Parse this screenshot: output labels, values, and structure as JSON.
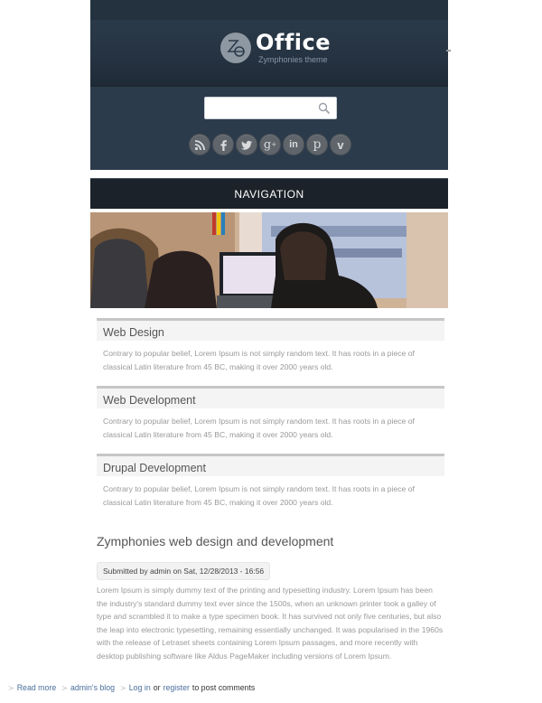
{
  "header": {
    "logo_mark": "Ze",
    "title": "Office",
    "subtitle": "Zymphonies theme"
  },
  "search": {
    "value": "",
    "placeholder": ""
  },
  "social": [
    {
      "name": "rss",
      "icon": "rss-icon"
    },
    {
      "name": "facebook",
      "icon": "facebook-icon"
    },
    {
      "name": "twitter",
      "icon": "twitter-icon"
    },
    {
      "name": "google-plus",
      "icon": "google-plus-icon"
    },
    {
      "name": "linkedin",
      "icon": "linkedin-icon"
    },
    {
      "name": "pinterest",
      "icon": "pinterest-icon"
    },
    {
      "name": "vimeo",
      "icon": "vimeo-icon"
    }
  ],
  "nav": {
    "label": "NAVIGATION"
  },
  "blocks": [
    {
      "title": "Web Design",
      "body": "Contrary to popular belief, Lorem Ipsum is not simply random text. It has roots in a piece of classical Latin literature from 45 BC, making it over 2000 years old."
    },
    {
      "title": "Web Development",
      "body": "Contrary to popular belief, Lorem Ipsum is not simply random text. It has roots in a piece of classical Latin literature from 45 BC, making it over 2000 years old."
    },
    {
      "title": "Drupal Development",
      "body": "Contrary to popular belief, Lorem Ipsum is not simply random text. It has roots in a piece of classical Latin literature from 45 BC, making it over 2000 years old."
    }
  ],
  "article": {
    "title": "Zymphonies web design and development",
    "submitted": "Submitted by admin on Sat, 12/28/2013 - 16:56",
    "body": "Lorem Ipsum is simply dummy text of the printing and typesetting industry. Lorem Ipsum has been the industry's standard dummy text ever since the 1500s, when an unknown printer took a galley of type and scrambled it to make a type specimen book. It has survived not only five centuries, but also the leap into electronic typesetting, remaining essentially unchanged. It was popularised in the 1960s with the release of Letraset sheets containing Lorem Ipsum passages, and more recently with desktop publishing software like Aldus PageMaker including versions of Lorem Ipsum.",
    "links": {
      "read_more": "Read more",
      "blog": "admin's blog",
      "login": "Log in",
      "or": "or",
      "register": "register",
      "suffix": "to post comments"
    }
  },
  "colors": {
    "header_bg": "#2c3b4b",
    "nav_bg": "#1b2229",
    "link": "#4a6f9c",
    "body_text": "#999999"
  }
}
